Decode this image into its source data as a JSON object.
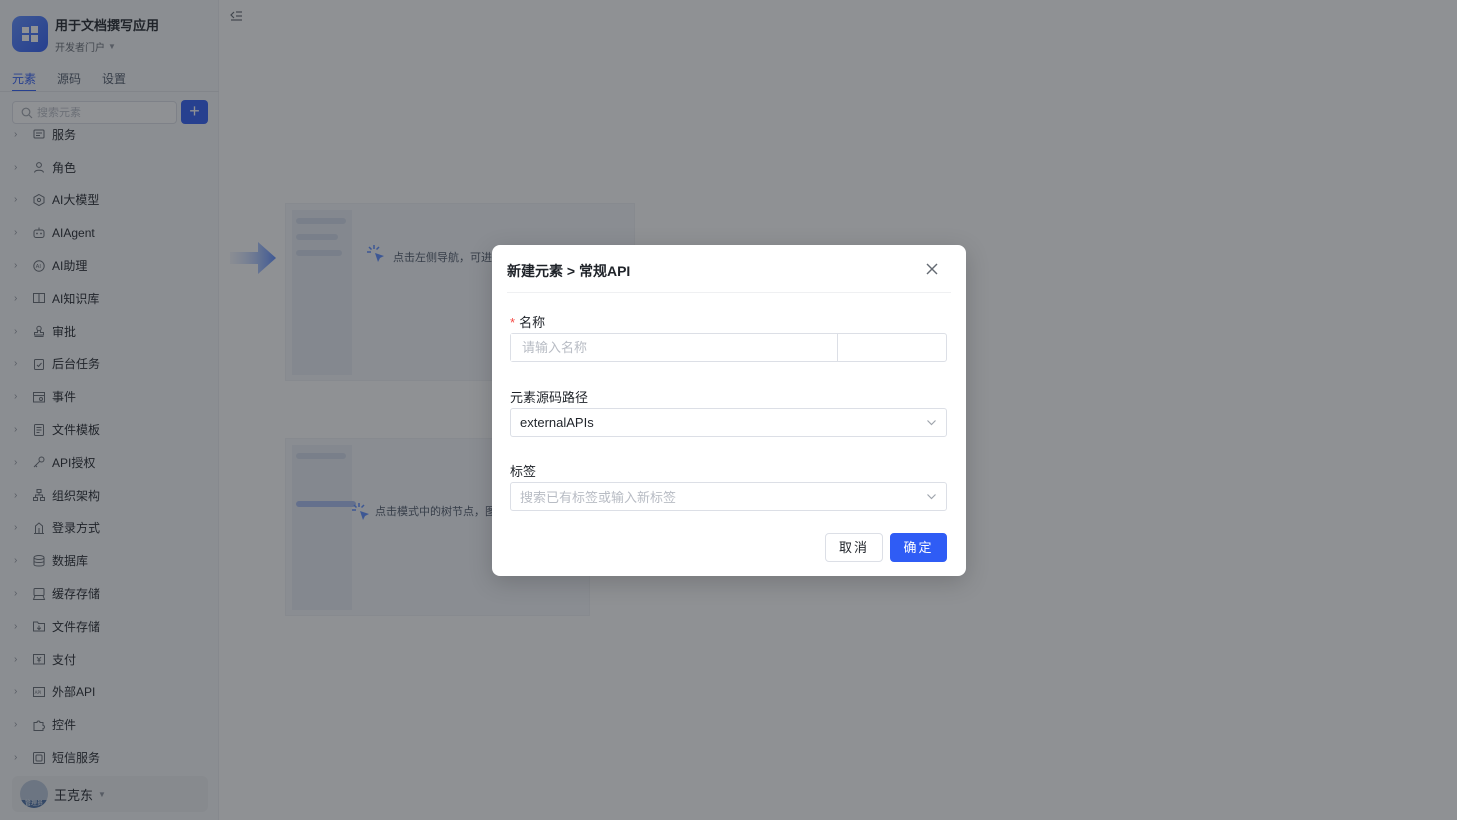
{
  "app": {
    "title": "用于文档撰写应用",
    "portal": "开发者门户"
  },
  "sidebar": {
    "tabs": [
      {
        "label": "元素",
        "active": true
      },
      {
        "label": "源码",
        "active": false
      },
      {
        "label": "设置",
        "active": false
      }
    ],
    "search_placeholder": "搜索元素",
    "add_label": "+",
    "items": [
      {
        "label": "服务",
        "icon": "service-icon"
      },
      {
        "label": "角色",
        "icon": "role-icon"
      },
      {
        "label": "AI大模型",
        "icon": "ai-model-icon"
      },
      {
        "label": "AIAgent",
        "icon": "robot-icon"
      },
      {
        "label": "AI助理",
        "icon": "ai-assistant-icon"
      },
      {
        "label": "AI知识库",
        "icon": "knowledge-base-icon"
      },
      {
        "label": "审批",
        "icon": "approval-stamp-icon"
      },
      {
        "label": "后台任务",
        "icon": "task-clipboard-icon"
      },
      {
        "label": "事件",
        "icon": "event-icon"
      },
      {
        "label": "文件模板",
        "icon": "file-template-icon"
      },
      {
        "label": "API授权",
        "icon": "key-icon"
      },
      {
        "label": "组织架构",
        "icon": "org-chart-icon"
      },
      {
        "label": "登录方式",
        "icon": "login-icon"
      },
      {
        "label": "数据库",
        "icon": "database-icon"
      },
      {
        "label": "缓存存储",
        "icon": "cache-icon"
      },
      {
        "label": "文件存储",
        "icon": "file-storage-icon"
      },
      {
        "label": "支付",
        "icon": "payment-icon"
      },
      {
        "label": "外部API",
        "icon": "api-icon"
      },
      {
        "label": "控件",
        "icon": "puzzle-icon"
      },
      {
        "label": "短信服务",
        "icon": "sms-icon"
      }
    ],
    "user": {
      "name": "王克东",
      "avatar_tag": "管理员"
    }
  },
  "main": {
    "guide_1": "点击左侧导航，可进",
    "guide_2": "点击模式中的树节点，图"
  },
  "modal": {
    "title": "新建元素 > 常规API",
    "name_label": "名称",
    "name_placeholder": "请输入名称",
    "path_label": "元素源码路径",
    "path_value": "externalAPIs",
    "tag_label": "标签",
    "tag_placeholder": "搜索已有标签或输入新标签",
    "cancel_label": "取消",
    "ok_label": "确定"
  },
  "colors": {
    "primary": "#2f5cf5",
    "required": "#f54a45",
    "mask": "rgba(31,35,41,0.5)"
  }
}
